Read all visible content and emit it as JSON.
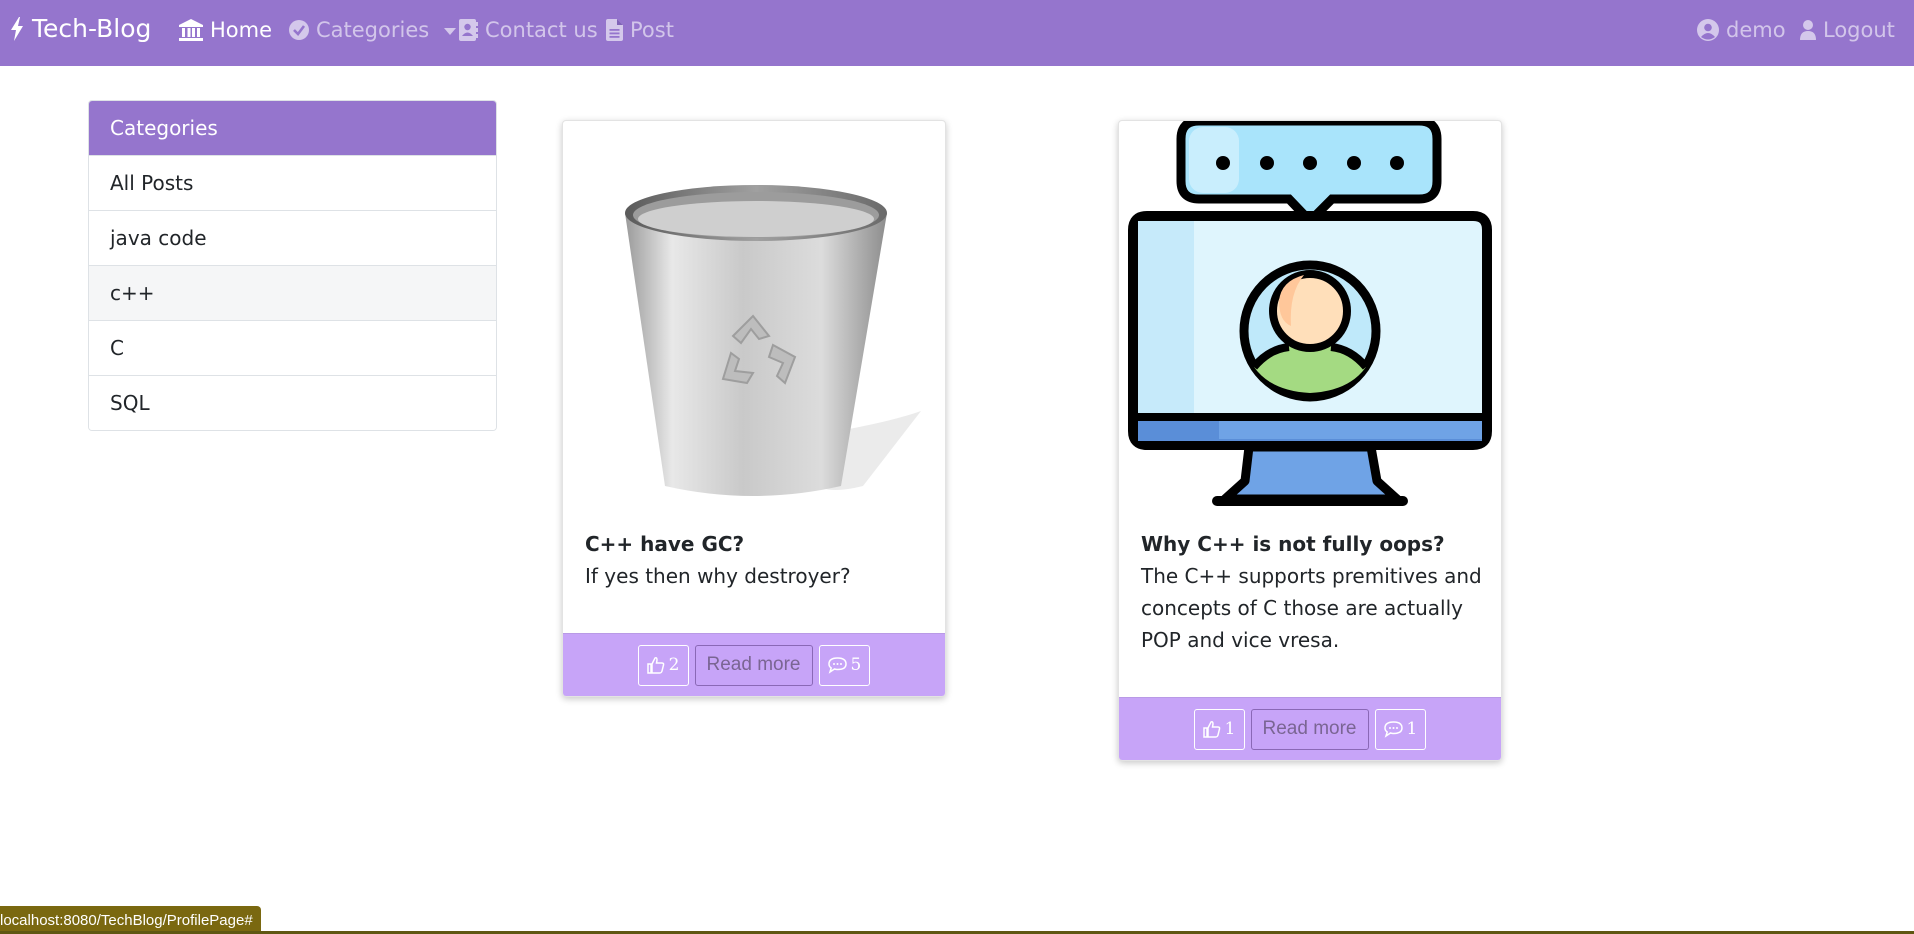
{
  "brand": {
    "name": "Tech-Blog",
    "icon": "bolt-icon"
  },
  "nav": {
    "home": "Home",
    "categories": "Categories",
    "contact": "Contact us",
    "post": "Post",
    "user": "demo",
    "logout": "Logout"
  },
  "sidebar": {
    "header": "Categories",
    "items": [
      {
        "label": "All Posts"
      },
      {
        "label": "java code"
      },
      {
        "label": "c++"
      },
      {
        "label": "C"
      },
      {
        "label": "SQL"
      }
    ]
  },
  "posts": [
    {
      "title": "C++ have GC?",
      "content": "If yes then why destroyer?",
      "likes": "2",
      "read_more": "Read more",
      "comments": "5",
      "image": "recycle-bin-image"
    },
    {
      "title": "Why C++ is not fully oops?",
      "content": "The C++ supports premitives and concepts of C those are actually POP and vice vresa.",
      "likes": "1",
      "read_more": "Read more",
      "comments": "1",
      "image": "monitor-user-chat-image"
    }
  ],
  "status_url": "localhost:8080/TechBlog/ProfilePage#",
  "colors": {
    "navbar": "#9575cd",
    "card_footer": "#c7a4f8"
  }
}
